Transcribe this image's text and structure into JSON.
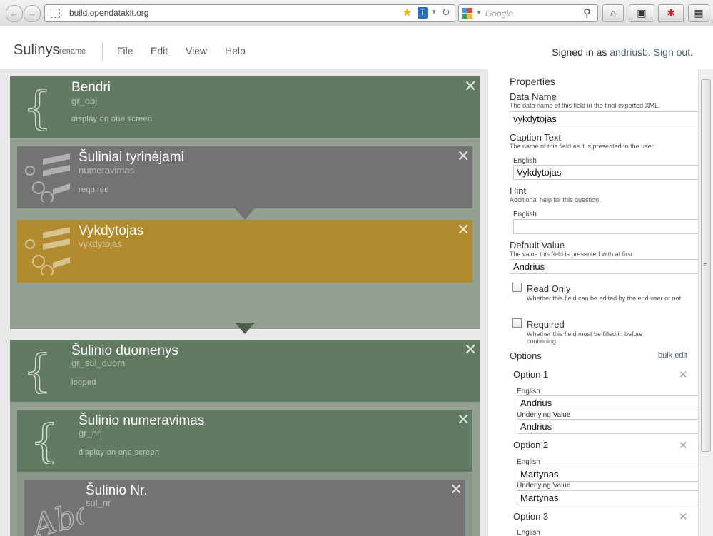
{
  "browser": {
    "url": "build.opendatakit.org",
    "search_placeholder": "Google"
  },
  "app": {
    "brand": "Sulinys",
    "rename_label": "rename",
    "menu": [
      "File",
      "Edit",
      "View",
      "Help"
    ],
    "signed_in_prefix": "Signed in as",
    "username": "andriusb",
    "sign_out_label": "Sign out",
    "sign_out_suffix": "."
  },
  "workspace": {
    "cards": [
      {
        "title": "Bendri",
        "name": "gr_obj",
        "meta": "display on one screen",
        "kind": "group"
      },
      {
        "title": "Šuliniai tyrinėjami",
        "name": "numeravimas",
        "meta": "required",
        "kind": "select"
      },
      {
        "title": "Vykdytojas",
        "name": "vykdytojas",
        "meta": "",
        "kind": "select"
      },
      {
        "title": "Šulinio duomenys",
        "name": "gr_sul_duom",
        "meta": "looped",
        "kind": "group"
      },
      {
        "title": "Šulinio numeravimas",
        "name": "gr_nr",
        "meta": "display on one screen",
        "kind": "group"
      },
      {
        "title": "Šulinio Nr.",
        "name": "sul_nr",
        "meta": "",
        "kind": "text"
      }
    ]
  },
  "properties": {
    "heading": "Properties",
    "data_name": {
      "label": "Data Name",
      "desc": "The data name of this field in the final exported XML.",
      "value": "vykdytojas"
    },
    "caption": {
      "label": "Caption Text",
      "desc": "The name of this field as it is presented to the user.",
      "lang": "English",
      "value": "Vykdytojas"
    },
    "hint": {
      "label": "Hint",
      "desc": "Additional help for this question.",
      "lang": "English",
      "value": ""
    },
    "default_value": {
      "label": "Default Value",
      "desc": "The value this field is presented with at first.",
      "value": "Andrius"
    },
    "read_only": {
      "label": "Read Only",
      "desc": "Whether this field can be edited by the end user or not.",
      "checked": false
    },
    "required": {
      "label": "Required",
      "desc": "Whether this field must be filled in before continuing.",
      "checked": false
    },
    "options_label": "Options",
    "bulk_edit_label": "bulk edit",
    "options": [
      {
        "label": "Option 1",
        "lang": "English",
        "text": "Andrius",
        "underlying_label": "Underlying Value",
        "value": "Andrius"
      },
      {
        "label": "Option 2",
        "lang": "English",
        "text": "Martynas",
        "underlying_label": "Underlying Value",
        "value": "Martynas"
      },
      {
        "label": "Option 3",
        "lang": "English"
      }
    ]
  }
}
